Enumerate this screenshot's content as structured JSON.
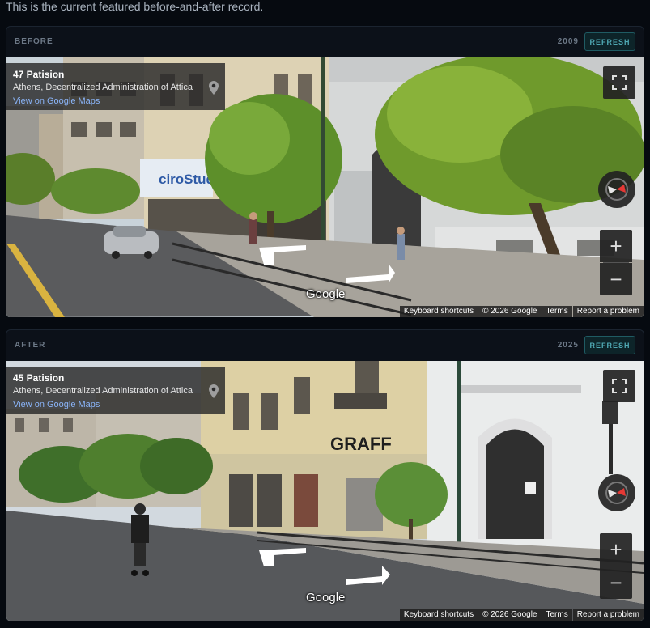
{
  "intro_text": "This is the current featured before-and-after record.",
  "before": {
    "label": "BEFORE",
    "year": "2009",
    "refresh_label": "REFRESH",
    "place_title": "47 Patision",
    "place_sub": "Athens, Decentralized Administration of Attica",
    "maps_link": "View on Google Maps"
  },
  "after": {
    "label": "AFTER",
    "year": "2025",
    "refresh_label": "REFRESH",
    "place_title": "45 Patision",
    "place_sub": "Athens, Decentralized Administration of Attica",
    "maps_link": "View on Google Maps"
  },
  "viewer": {
    "google_logo": "Google",
    "zoom_in": "+",
    "zoom_out": "−",
    "footer": {
      "shortcuts": "Keyboard shortcuts",
      "copyright": "© 2026 Google",
      "terms": "Terms",
      "report": "Report a problem"
    }
  },
  "icons": {
    "pin": "map-pin-icon",
    "fullscreen": "fullscreen-icon",
    "compass": "compass-icon"
  },
  "colors": {
    "accent": "#4fa8b3",
    "link": "#8ab4f8",
    "background": "#060a10"
  }
}
